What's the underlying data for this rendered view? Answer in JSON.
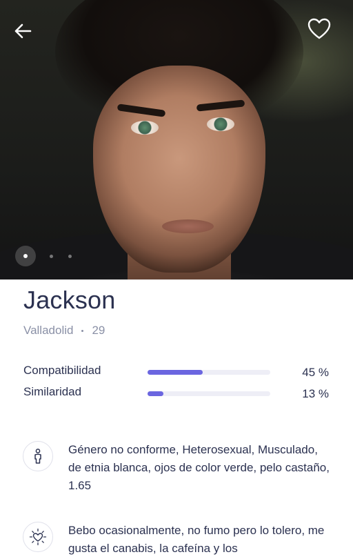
{
  "profile": {
    "name": "Jackson",
    "city": "Valladolid",
    "age": "29"
  },
  "photo": {
    "current_index": 1,
    "total": 3
  },
  "stats": [
    {
      "label": "Compatibilidad",
      "value": 45,
      "display": "45 %"
    },
    {
      "label": "Similaridad",
      "value": 13,
      "display": "13 %"
    }
  ],
  "details": {
    "identity": {
      "icon": "person-icon",
      "text": "Género no conforme, Heterosexual, Musculado, de etnia blanca, ojos de color verde, pelo castaño, 1.65"
    },
    "habits": {
      "icon": "heart-sparkle-icon",
      "text": "Bebo ocasionalmente, no fumo pero lo tolero, me gusta el canabis, la cafeína y los"
    }
  },
  "colors": {
    "accent": "#6b66e0",
    "text": "#2b3150",
    "muted": "#8a90a6",
    "track": "#eeeef6"
  }
}
